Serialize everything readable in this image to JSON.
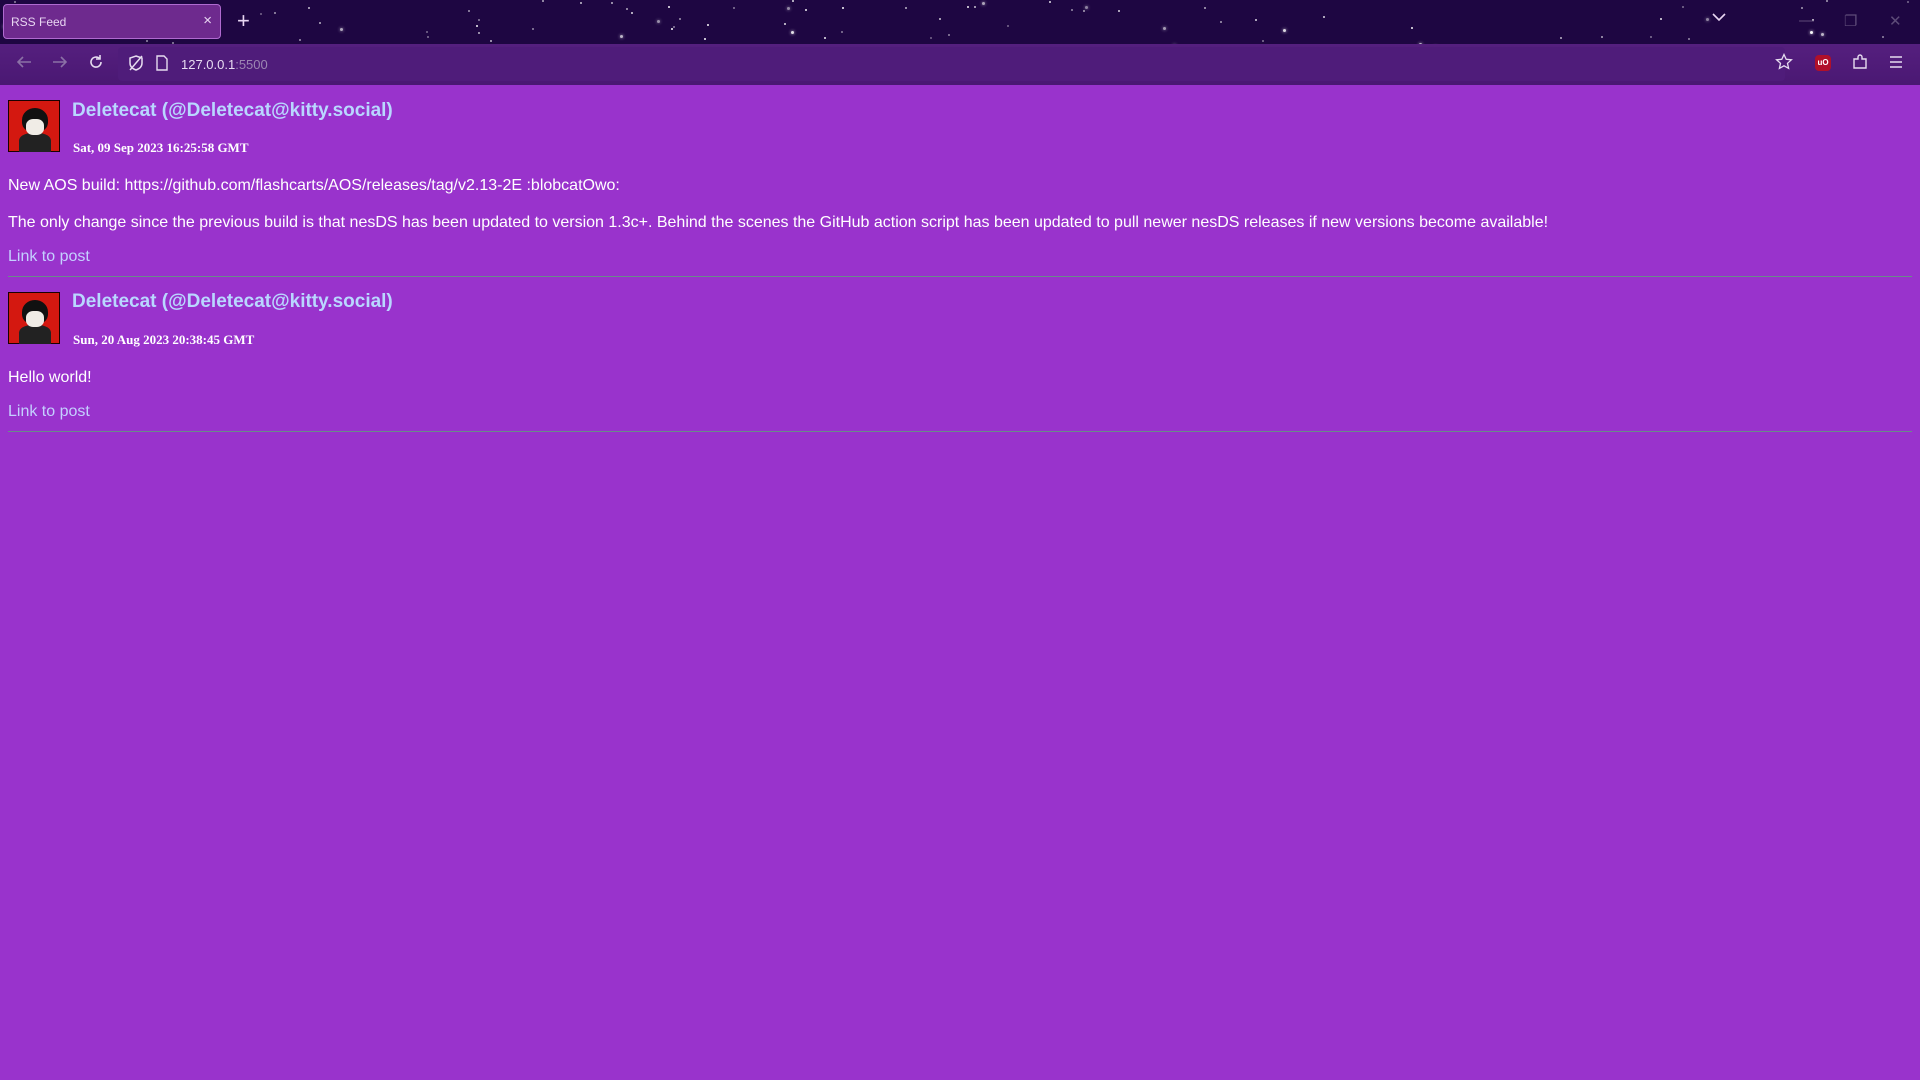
{
  "browser": {
    "tab_title": "RSS Feed",
    "tab_close": "×",
    "new_tab": "+",
    "tab_list_icon": "chevron-down-icon",
    "url_host": "127.0.0.1",
    "url_port": ":5500",
    "extension_badge": "uO"
  },
  "posts": [
    {
      "author": "Deletecat (@Deletecat@kitty.social)",
      "date": "Sat, 09 Sep 2023 16:25:58 GMT",
      "paragraphs": [
        "New AOS build: https://github.com/flashcarts/AOS/releases/tag/v2.13-2E :blobcatOwo:",
        "The only change since the previous build is that nesDS has been updated to version 1.3c+. Behind the scenes the GitHub action script has been updated to pull newer nesDS releases if new versions become available!"
      ],
      "link_label": "Link to post"
    },
    {
      "author": "Deletecat (@Deletecat@kitty.social)",
      "date": "Sun, 20 Aug 2023 20:38:45 GMT",
      "paragraphs": [
        "Hello world!"
      ],
      "link_label": "Link to post"
    }
  ],
  "colors": {
    "page_background": "#9933cc",
    "author_link": "#b9d7ff",
    "post_link": "#c4d0ff",
    "browser_frame": "#1e0642"
  }
}
